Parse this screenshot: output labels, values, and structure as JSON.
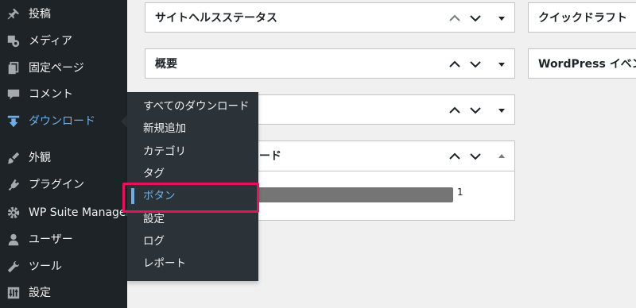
{
  "sidebar": {
    "items": [
      {
        "label": "投稿",
        "icon": "pin-icon"
      },
      {
        "label": "メディア",
        "icon": "media-icon"
      },
      {
        "label": "固定ページ",
        "icon": "page-icon"
      },
      {
        "label": "コメント",
        "icon": "comment-icon"
      },
      {
        "label": "ダウンロード",
        "icon": "download-icon",
        "current": true
      },
      {
        "label": "外観",
        "icon": "brush-icon"
      },
      {
        "label": "プラグイン",
        "icon": "plugin-icon"
      },
      {
        "label": "WP Suite Manager",
        "icon": "gear-icon"
      },
      {
        "label": "ユーザー",
        "icon": "user-icon"
      },
      {
        "label": "ツール",
        "icon": "wrench-icon"
      },
      {
        "label": "設定",
        "icon": "settings-icon"
      }
    ]
  },
  "flyout": {
    "items": [
      "すべてのダウンロード",
      "新規追加",
      "カテゴリ",
      "タグ",
      "ボタン",
      "設定",
      "ログ",
      "レポート"
    ],
    "active": "ボタン"
  },
  "widgets": {
    "site_health": "サイトヘルスステータス",
    "overview": "概要",
    "downloads_partial": "ード",
    "quick_draft": "クイックドラフト",
    "wp_events": "WordPress イベント"
  },
  "download_count": "1",
  "colors": {
    "sidebar_bg": "#1d2327",
    "flyout_bg": "#2c3338",
    "accent": "#72aee6",
    "highlight": "#e5135a",
    "bar": "#757575"
  }
}
